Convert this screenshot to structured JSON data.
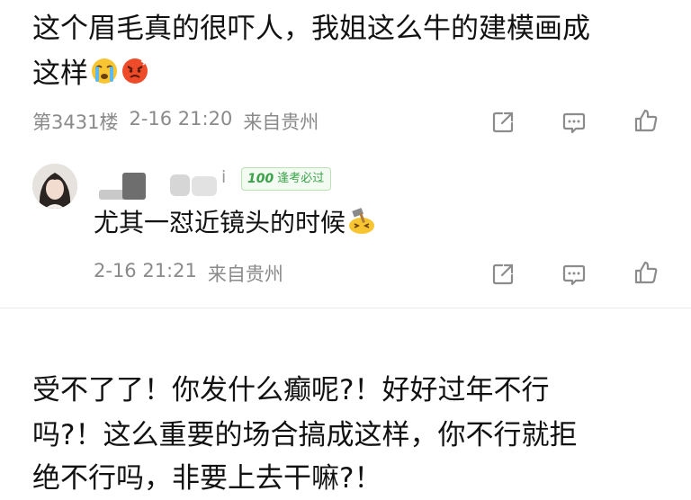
{
  "comment1": {
    "text_line1": "这个眉毛真的很吓人，我姐这么牛的建模画成",
    "text_line2": "这样",
    "emojis": [
      "crying-face-icon",
      "angry-face-icon"
    ],
    "floor": "第3431楼",
    "date": "2-16 21:20",
    "location": "来自贵州"
  },
  "reply": {
    "username_visible": "i",
    "badge_number": "100",
    "badge_text": "逢考必过",
    "text": "尤其一怼近镜头的时候",
    "emoji": "hammer-icon",
    "date": "2-16 21:21",
    "location": "来自贵州"
  },
  "comment2": {
    "line1": "受不了了！你发什么癫呢?！好好过年不行",
    "line2": "吗?！这么重要的场合搞成这样，你不行就拒",
    "line3": "绝不行吗，非要上去干嘛?！"
  }
}
